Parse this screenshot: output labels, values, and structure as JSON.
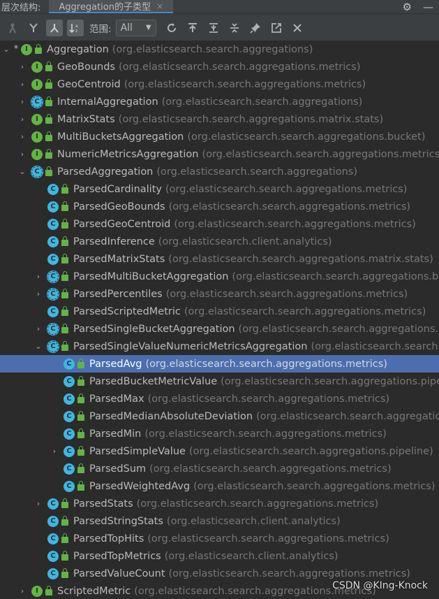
{
  "titlebar": {
    "label": "层次结构:",
    "tab": "Aggregation的子类型",
    "tab_close": "×",
    "gear": "⚙",
    "minimize": "—"
  },
  "toolbar": {
    "scope_label": "范围:",
    "scope_value": "All",
    "scope_arrow": "▼"
  },
  "tree": [
    {
      "depth": 0,
      "chev": "⌄",
      "star": "*",
      "kind": "I",
      "name": "Aggregation",
      "pkg": "(org.elasticsearch.search.aggregations)"
    },
    {
      "depth": 1,
      "chev": "›",
      "kind": "I",
      "name": "GeoBounds",
      "pkg": "(org.elasticsearch.search.aggregations.metrics)"
    },
    {
      "depth": 1,
      "chev": "›",
      "kind": "I",
      "name": "GeoCentroid",
      "pkg": "(org.elasticsearch.search.aggregations.metrics)"
    },
    {
      "depth": 1,
      "chev": "›",
      "kind": "A",
      "name": "InternalAggregation",
      "pkg": "(org.elasticsearch.search.aggregations)"
    },
    {
      "depth": 1,
      "chev": "›",
      "kind": "I",
      "name": "MatrixStats",
      "pkg": "(org.elasticsearch.search.aggregations.matrix.stats)"
    },
    {
      "depth": 1,
      "chev": "›",
      "kind": "I",
      "name": "MultiBucketsAggregation",
      "pkg": "(org.elasticsearch.search.aggregations.bucket)"
    },
    {
      "depth": 1,
      "chev": "›",
      "kind": "I",
      "name": "NumericMetricsAggregation",
      "pkg": "(org.elasticsearch.search.aggregations.metrics)"
    },
    {
      "depth": 1,
      "chev": "⌄",
      "kind": "A",
      "name": "ParsedAggregation",
      "pkg": "(org.elasticsearch.search.aggregations)"
    },
    {
      "depth": 2,
      "chev": "",
      "kind": "C",
      "name": "ParsedCardinality",
      "pkg": "(org.elasticsearch.search.aggregations.metrics)"
    },
    {
      "depth": 2,
      "chev": "",
      "kind": "C",
      "name": "ParsedGeoBounds",
      "pkg": "(org.elasticsearch.search.aggregations.metrics)"
    },
    {
      "depth": 2,
      "chev": "",
      "kind": "C",
      "name": "ParsedGeoCentroid",
      "pkg": "(org.elasticsearch.search.aggregations.metrics)"
    },
    {
      "depth": 2,
      "chev": "",
      "kind": "C",
      "name": "ParsedInference",
      "pkg": "(org.elasticsearch.client.analytics)"
    },
    {
      "depth": 2,
      "chev": "",
      "kind": "C",
      "name": "ParsedMatrixStats",
      "pkg": "(org.elasticsearch.search.aggregations.matrix.stats)"
    },
    {
      "depth": 2,
      "chev": "›",
      "kind": "A",
      "name": "ParsedMultiBucketAggregation",
      "pkg": "(org.elasticsearch.search.aggregations.bucket)"
    },
    {
      "depth": 2,
      "chev": "›",
      "kind": "A",
      "name": "ParsedPercentiles",
      "pkg": "(org.elasticsearch.search.aggregations.metrics)"
    },
    {
      "depth": 2,
      "chev": "",
      "kind": "C",
      "name": "ParsedScriptedMetric",
      "pkg": "(org.elasticsearch.search.aggregations.metrics)"
    },
    {
      "depth": 2,
      "chev": "›",
      "kind": "A",
      "name": "ParsedSingleBucketAggregation",
      "pkg": "(org.elasticsearch.search.aggregations.bucket)"
    },
    {
      "depth": 2,
      "chev": "⌄",
      "kind": "A",
      "name": "ParsedSingleValueNumericMetricsAggregation",
      "pkg": "(org.elasticsearch.search.aggregations.metrics)"
    },
    {
      "depth": 3,
      "chev": "",
      "kind": "C",
      "name": "ParsedAvg",
      "pkg": "(org.elasticsearch.search.aggregations.metrics)",
      "selected": true
    },
    {
      "depth": 3,
      "chev": "",
      "kind": "C",
      "name": "ParsedBucketMetricValue",
      "pkg": "(org.elasticsearch.search.aggregations.pipeline)"
    },
    {
      "depth": 3,
      "chev": "",
      "kind": "C",
      "name": "ParsedMax",
      "pkg": "(org.elasticsearch.search.aggregations.metrics)"
    },
    {
      "depth": 3,
      "chev": "",
      "kind": "C",
      "name": "ParsedMedianAbsoluteDeviation",
      "pkg": "(org.elasticsearch.search.aggregations.metrics)"
    },
    {
      "depth": 3,
      "chev": "",
      "kind": "C",
      "name": "ParsedMin",
      "pkg": "(org.elasticsearch.search.aggregations.metrics)"
    },
    {
      "depth": 3,
      "chev": "›",
      "kind": "C",
      "name": "ParsedSimpleValue",
      "pkg": "(org.elasticsearch.search.aggregations.pipeline)"
    },
    {
      "depth": 3,
      "chev": "",
      "kind": "C",
      "name": "ParsedSum",
      "pkg": "(org.elasticsearch.search.aggregations.metrics)"
    },
    {
      "depth": 3,
      "chev": "",
      "kind": "C",
      "name": "ParsedWeightedAvg",
      "pkg": "(org.elasticsearch.search.aggregations.metrics)"
    },
    {
      "depth": 2,
      "chev": "›",
      "kind": "C",
      "name": "ParsedStats",
      "pkg": "(org.elasticsearch.search.aggregations.metrics)"
    },
    {
      "depth": 2,
      "chev": "",
      "kind": "C",
      "name": "ParsedStringStats",
      "pkg": "(org.elasticsearch.client.analytics)"
    },
    {
      "depth": 2,
      "chev": "",
      "kind": "C",
      "name": "ParsedTopHits",
      "pkg": "(org.elasticsearch.search.aggregations.metrics)"
    },
    {
      "depth": 2,
      "chev": "",
      "kind": "C",
      "name": "ParsedTopMetrics",
      "pkg": "(org.elasticsearch.client.analytics)"
    },
    {
      "depth": 2,
      "chev": "",
      "kind": "C",
      "name": "ParsedValueCount",
      "pkg": "(org.elasticsearch.search.aggregations.metrics)"
    },
    {
      "depth": 1,
      "chev": "›",
      "kind": "I",
      "name": "ScriptedMetric",
      "pkg": "(org.elasticsearch.search.aggregations.metrics)"
    }
  ],
  "watermark": "CSDN @KIng-Knock"
}
